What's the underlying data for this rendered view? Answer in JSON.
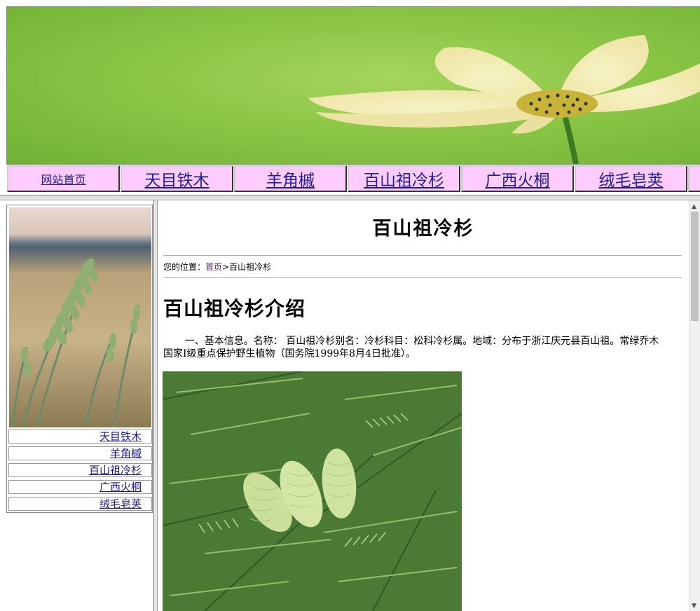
{
  "nav": {
    "items": [
      {
        "label": "网站首页"
      },
      {
        "label": "天目铁木"
      },
      {
        "label": "羊角槭"
      },
      {
        "label": "百山祖冷杉"
      },
      {
        "label": "广西火桐"
      },
      {
        "label": "绒毛皂荚"
      }
    ]
  },
  "sidebar": {
    "links": [
      {
        "label": "天目铁木"
      },
      {
        "label": "羊角槭"
      },
      {
        "label": "百山祖冷杉"
      },
      {
        "label": "广西火桐"
      },
      {
        "label": "绒毛皂荚"
      }
    ]
  },
  "main": {
    "title": "百山祖冷杉",
    "breadcrumb": {
      "prefix": "您的位置：",
      "home": "首页",
      "separator": ">",
      "current": "百山祖冷杉"
    },
    "heading": "百山祖冷杉介绍",
    "intro": "一、基本信息。名称：  百山祖冷杉别名：冷杉科目：松科冷杉属。地域：分布于浙江庆元县百山祖。常绿乔木国家Ⅰ级重点保护野生植物（国务院1999年8月4日批准）。"
  },
  "icons": {
    "scroll_up": "scroll-up-arrow-icon",
    "scroll_down": "scroll-down-arrow-icon"
  },
  "colors": {
    "nav_bg": "#ffccff",
    "link": "#1a1a8c",
    "banner_green": "#8cc646"
  }
}
